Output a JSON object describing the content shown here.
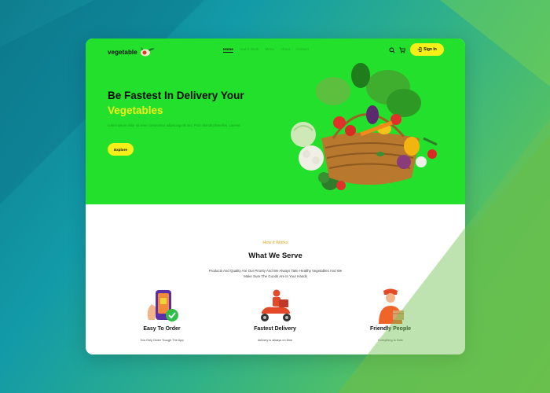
{
  "brand": {
    "logo_text": "vegetable"
  },
  "nav": {
    "items": [
      {
        "label": "Home",
        "active": true
      },
      {
        "label": "How it Work",
        "active": false
      },
      {
        "label": "Menu",
        "active": false
      },
      {
        "label": "About",
        "active": false
      },
      {
        "label": "Contact",
        "active": false
      }
    ]
  },
  "header": {
    "signin_label": "Sign In"
  },
  "hero": {
    "title_line1": "Be Fastest In Delivery Your",
    "title_line2": "Vegetables",
    "description": "Lorem ipsum dolor sit amet consectetur adipiscing elit sed. Proin blandit phasellus. Laoreet.",
    "cta_label": "Explore"
  },
  "section": {
    "eyebrow": "How it Works",
    "title": "What We Serve",
    "subtitle": "Products And Quality Are Our Priority And We Always Take Healthy Vegetables And We Make Sure The Goods Are In Your Hands"
  },
  "features": [
    {
      "title": "Easy To Order",
      "description": "You Only Order Trough The App"
    },
    {
      "title": "Fastest Delivery",
      "description": "delivery is always on time"
    },
    {
      "title": "Friendly People",
      "description": "Everything Is Safe"
    }
  ],
  "colors": {
    "hero_green": "#22e02b",
    "accent_yellow": "#f4ef18",
    "eyebrow_orange": "#e0a020"
  }
}
